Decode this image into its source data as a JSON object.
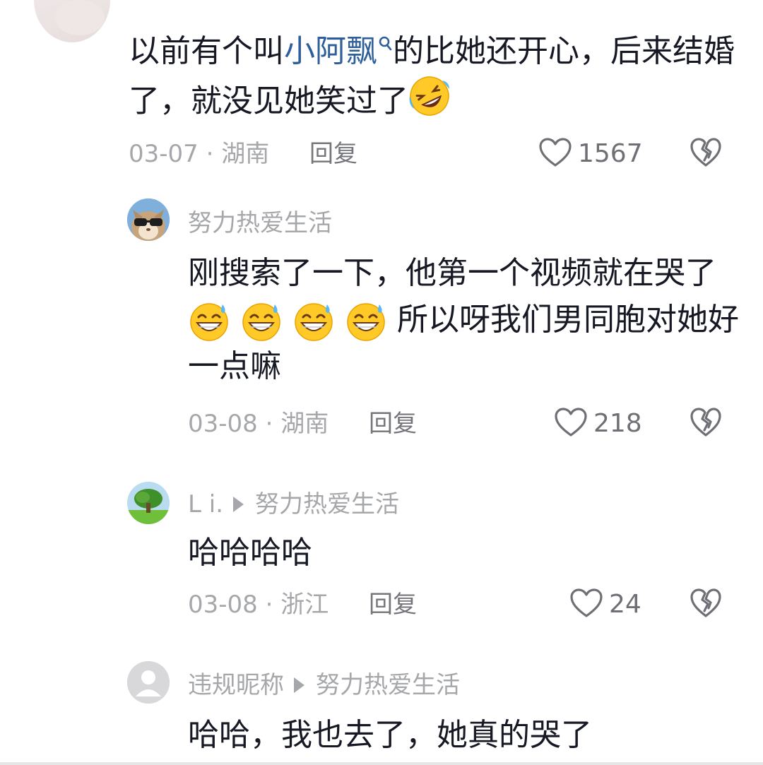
{
  "comments": [
    {
      "content_before": "以前有个叫",
      "link_text": "小阿飘",
      "content_after": "的比她还开心，后来结婚了，就没见她笑过了",
      "emoji": "rolling-on-floor-laughing",
      "date": "03-07",
      "location": "湖南",
      "reply_label": "回复",
      "likes": "1567"
    },
    {
      "user": "努力热爱生活",
      "content_line1": "刚搜索了一下，他第一个视频就在哭了",
      "emojis": [
        "grinning-sweat",
        "grinning-sweat",
        "grinning-sweat",
        "grinning-sweat"
      ],
      "content_line2": "所以呀我们男同胞对她好",
      "content_line3": "一点嘛",
      "date": "03-08",
      "location": "湖南",
      "reply_label": "回复",
      "likes": "218"
    },
    {
      "user": "L i.",
      "reply_to": "努力热爱生活",
      "content": "哈哈哈哈",
      "date": "03-08",
      "location": "浙江",
      "reply_label": "回复",
      "likes": "24"
    },
    {
      "user": "违规昵称",
      "reply_to": "努力热爱生活",
      "content": "哈哈，我也去了，她真的哭了"
    }
  ],
  "separator": " · ",
  "colors": {
    "text": "#161823",
    "muted": "#a6a7ab",
    "link": "#2f5f9a"
  }
}
